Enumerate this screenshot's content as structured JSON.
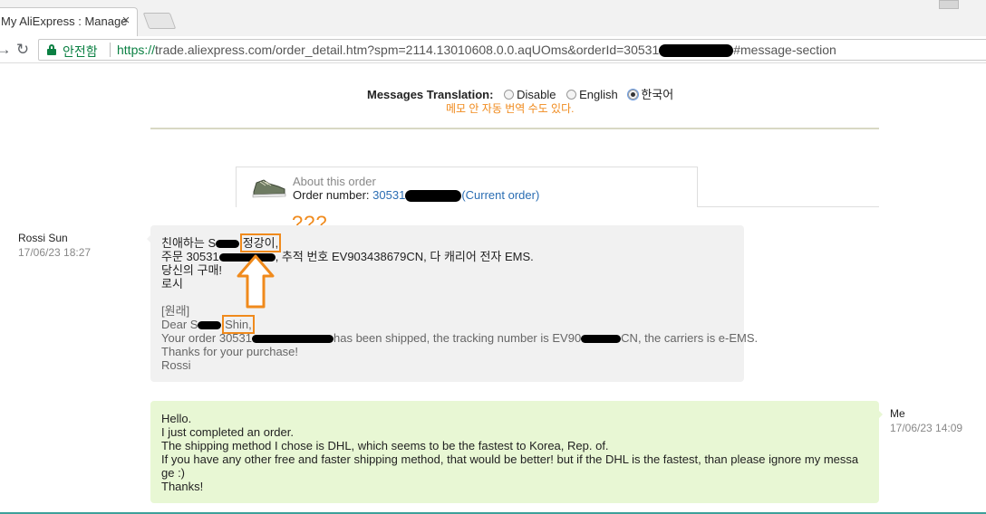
{
  "browser": {
    "tab_title": "My AliExpress : Manage",
    "tab_close": "×",
    "secure_label": "안전함",
    "url_scheme": "https://",
    "url_pre": "trade.aliexpress.com/order_detail.htm?spm=2114.13010608.0.0.aqUOms&orderId=30531",
    "url_post": "#message-section",
    "back_glyph": "←",
    "forward_glyph": "→",
    "reload_glyph": "↻"
  },
  "translation": {
    "label": "Messages Translation:",
    "options": [
      "Disable",
      "English",
      "한국어"
    ],
    "selected": "한국어",
    "note": "메모 안 자동 번역 수도 있다."
  },
  "about": {
    "title": "About this order",
    "number_label": "Order number:",
    "number_prefix": "30531",
    "current": "(Current order)"
  },
  "annotation": {
    "question": "???",
    "color": "#f08a1c"
  },
  "messages": {
    "incoming": {
      "sender": "Rossi Sun",
      "time": "17/06/23 18:27",
      "lines": {
        "greet_prefix": "친애하는 S",
        "greet_highlight": "정강이,",
        "order_prefix": "주문 30531",
        "order_suffix": ", 추적 번호 EV903438679CN, 다 캐리어 전자 EMS.",
        "thanks": "당신의 구매!",
        "sign": "로시",
        "orig_tag": "[원래]",
        "dear_prefix": "Dear S",
        "dear_highlight": "Shin,",
        "ship_prefix": "Your order 30531",
        "ship_mid": "has been shipped, the tracking number is EV90",
        "ship_suffix": "CN, the carriers is e-EMS.",
        "thanks_en": "Thanks for your purchase!",
        "sign_en": "Rossi"
      }
    },
    "outgoing": {
      "sender": "Me",
      "time": "17/06/23 14:09",
      "lines": [
        "Hello.",
        "I just completed an order.",
        "The shipping method I chose is DHL, which seems to be the fastest to Korea, Rep. of.",
        "If you have any other free and faster shipping method, that would be better! but if the DHL is the fastest, than please ignore my messa",
        "ge :)",
        "Thanks!"
      ]
    }
  },
  "colors": {
    "accent": "#f08a1c",
    "secure": "#0b8043",
    "link": "#2a6db3",
    "incoming_bg": "#f1f1f1",
    "outgoing_bg": "#e8f7d4"
  }
}
